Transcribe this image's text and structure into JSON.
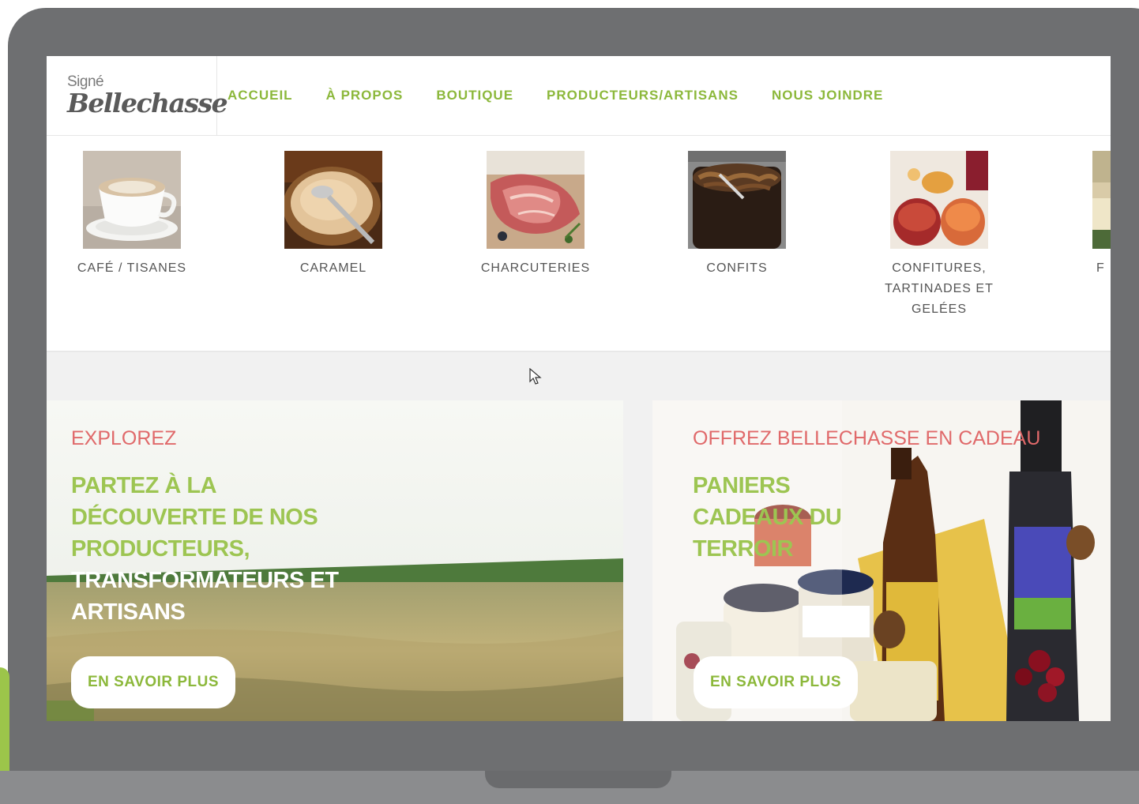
{
  "logo": {
    "small": "Signé",
    "main": "Bellechasse"
  },
  "nav": [
    {
      "label": "ACCUEIL"
    },
    {
      "label": "À PROPOS"
    },
    {
      "label": "BOUTIQUE"
    },
    {
      "label": "PRODUCTEURS/ARTISANS"
    },
    {
      "label": "NOUS JOINDRE"
    }
  ],
  "categories": [
    {
      "label": "CAFÉ / TISANES"
    },
    {
      "label": "CARAMEL"
    },
    {
      "label": "CHARCUTERIES"
    },
    {
      "label": "CONFITS"
    },
    {
      "label": "CONFITURES, TARTINADES ET GELÉES"
    },
    {
      "label": "F"
    }
  ],
  "promo_left": {
    "eyebrow": "EXPLOREZ",
    "title_green": "PARTEZ À LA DÉCOUVERTE DE NOS PRODUCTEURS,",
    "title_white": "TRANSFORMATEURS ET ARTISANS",
    "cta": "EN SAVOIR PLUS"
  },
  "promo_right": {
    "eyebrow": "OFFREZ BELLECHASSE EN CADEAU",
    "title": "PANIERS CADEAUX DU TERROIR",
    "cta": "EN SAVOIR PLUS"
  },
  "colors": {
    "accent_green": "#8cb83b",
    "eyebrow_red": "#e0696a",
    "frame": "#6e6f71"
  }
}
